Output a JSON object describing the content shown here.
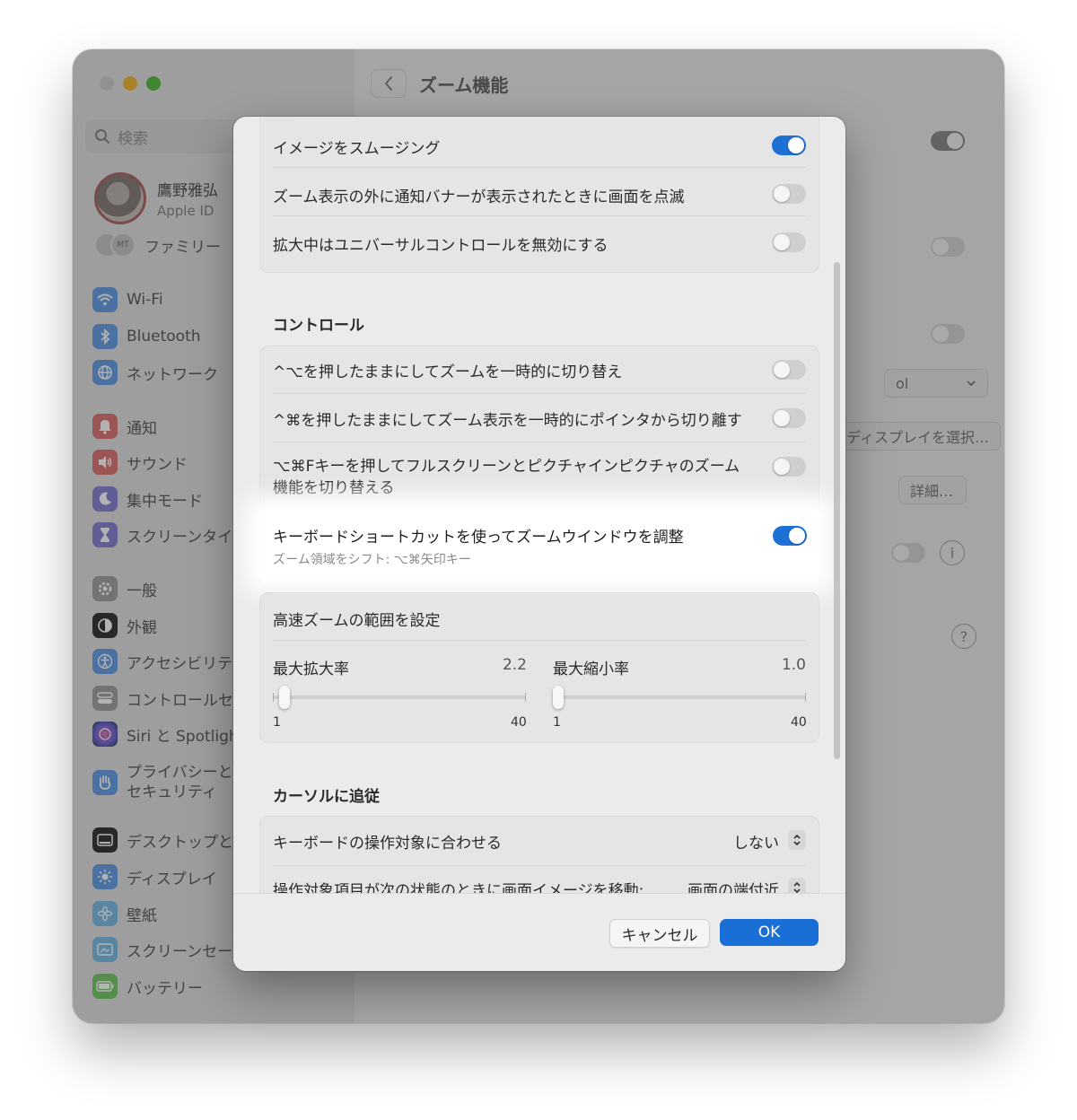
{
  "window": {
    "title": "ズーム機能",
    "search_placeholder": "検索"
  },
  "account": {
    "name": "鷹野雅弘",
    "subtitle": "Apple ID",
    "family_label": "ファミリー",
    "family_badge": "MT"
  },
  "sidebar": {
    "items": [
      {
        "label": "Wi-Fi",
        "icon": "wifi-icon",
        "color": "#6aa3e8"
      },
      {
        "label": "Bluetooth",
        "icon": "bluetooth-icon",
        "color": "#6aa3e8"
      },
      {
        "label": "ネットワーク",
        "icon": "globe-icon",
        "color": "#6aa3e8"
      },
      {
        "label": "通知",
        "icon": "bell-icon",
        "color": "#e07a7a"
      },
      {
        "label": "サウンド",
        "icon": "speaker-icon",
        "color": "#e07a7a"
      },
      {
        "label": "集中モード",
        "icon": "moon-icon",
        "color": "#8c86d6"
      },
      {
        "label": "スクリーンタイム",
        "icon": "hourglass-icon",
        "color": "#8c86d6"
      },
      {
        "label": "一般",
        "icon": "gear-icon",
        "color": "#a5a5a5"
      },
      {
        "label": "外観",
        "icon": "appearance-icon",
        "color": "#3a3a3a"
      },
      {
        "label": "アクセシビリティ",
        "icon": "accessibility-icon",
        "color": "#6aa3e8"
      },
      {
        "label": "コントロールセンター",
        "icon": "control-center-icon",
        "color": "#a5a5a5"
      },
      {
        "label": "Siri と Spotlight",
        "icon": "siri-icon",
        "color": "#9a6fc8"
      },
      {
        "label": "プライバシーと",
        "label2": "セキュリティ",
        "icon": "hand-icon",
        "color": "#6aa3e8"
      },
      {
        "label": "デスクトップとDock",
        "icon": "desktop-icon",
        "color": "#3a3a3a"
      },
      {
        "label": "ディスプレイ",
        "icon": "sun-icon",
        "color": "#6aa3e8"
      },
      {
        "label": "壁紙",
        "icon": "flower-icon",
        "color": "#7ec0e8"
      },
      {
        "label": "スクリーンセーバ",
        "icon": "screensaver-icon",
        "color": "#7ec0e8"
      },
      {
        "label": "バッテリー",
        "icon": "battery-icon",
        "color": "#7acb6e"
      }
    ]
  },
  "background": {
    "popup1": "ol",
    "button_display": "ディスプレイを選択…",
    "button_detail": "詳細…",
    "help": "?",
    "info": "i"
  },
  "dialog": {
    "top_rows": [
      {
        "label": "イメージをスムージング",
        "on": true
      },
      {
        "label": "ズーム表示の外に通知バナーが表示されたときに画面を点滅",
        "on": false
      },
      {
        "label": "拡大中はユニバーサルコントロールを無効にする",
        "on": false
      }
    ],
    "controls_header": "コントロール",
    "control_rows": [
      {
        "label": "^⌥を押したままにしてズームを一時的に切り替え",
        "on": false
      },
      {
        "label": "^⌘を押したままにしてズーム表示を一時的にポインタから切り離す",
        "on": false
      },
      {
        "label": "⌥⌘Fキーを押してフルスクリーンとピクチャインピクチャのズーム",
        "label2": "機能を切り替える",
        "on": false
      }
    ],
    "highlighted": {
      "label": "キーボードショートカットを使ってズームウインドウを調整",
      "sublabel": "ズーム領域をシフト: ⌥⌘矢印キー",
      "on": true
    },
    "speed_zoom": {
      "header": "高速ズームの範囲を設定",
      "max_zoom_label": "最大拡大率",
      "max_zoom_value": "2.2",
      "min_zoom_label": "最大縮小率",
      "min_zoom_value": "1.0",
      "range_min": "1",
      "range_max": "40"
    },
    "cursor_header": "カーソルに追従",
    "cursor_rows": [
      {
        "label": "キーボードの操作対象に合わせる",
        "value": "しない"
      },
      {
        "label": "操作対象項目が次の状態のときに画面イメージを移動:",
        "value": "画面の端付近"
      }
    ],
    "cancel": "キャンセル",
    "ok": "OK"
  }
}
